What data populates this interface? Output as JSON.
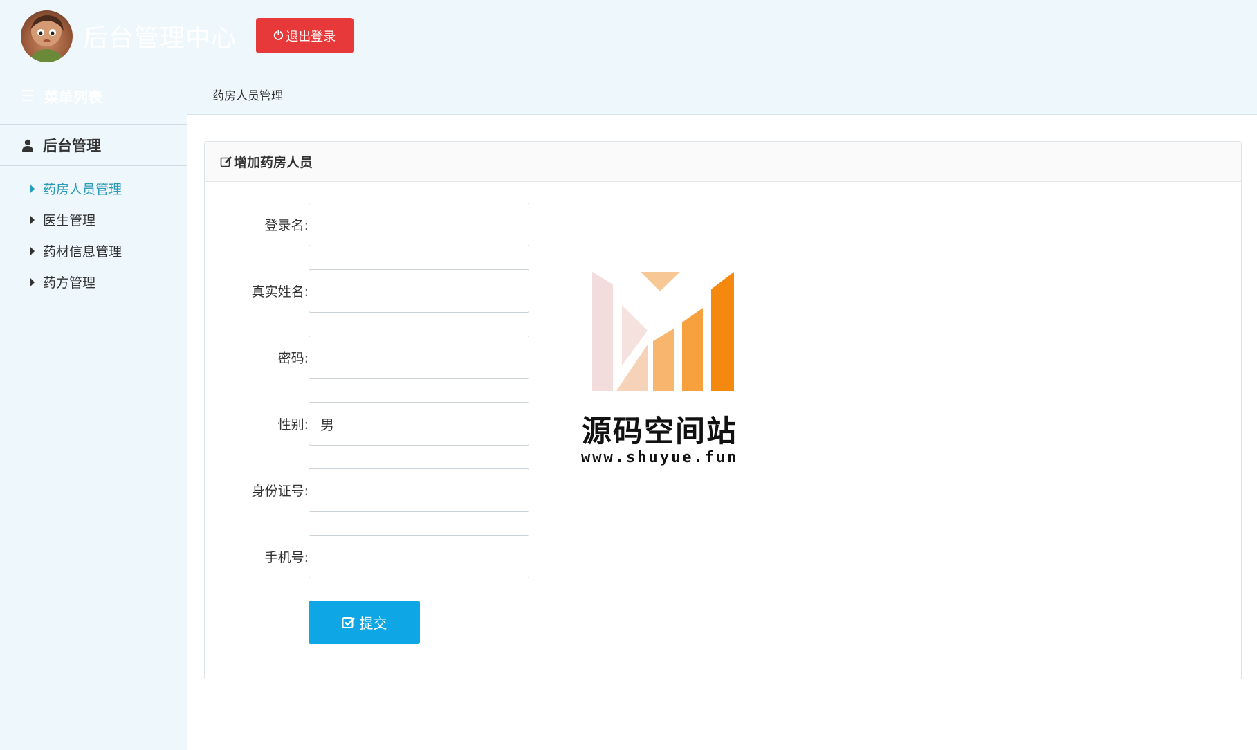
{
  "header": {
    "app_title": "后台管理中心",
    "logout_label": "退出登录",
    "logout_icon": "power-icon",
    "avatar_icon": "avatar"
  },
  "sidebar": {
    "menu_title": "菜单列表",
    "menu_icon": "list-icon",
    "group": {
      "title": "后台管理",
      "icon": "user-icon"
    },
    "items": [
      {
        "label": "药房人员管理",
        "active": true
      },
      {
        "label": "医生管理",
        "active": false
      },
      {
        "label": "药材信息管理",
        "active": false
      },
      {
        "label": "药方管理",
        "active": false
      }
    ]
  },
  "breadcrumb": {
    "current": "药房人员管理"
  },
  "panel": {
    "heading": "增加药房人员",
    "heading_icon": "edit-icon",
    "fields": [
      {
        "label": "登录名:",
        "value": ""
      },
      {
        "label": "真实姓名:",
        "value": ""
      },
      {
        "label": "密码:",
        "value": ""
      },
      {
        "label": "性别:",
        "value": "男"
      },
      {
        "label": "身份证号:",
        "value": ""
      },
      {
        "label": "手机号:",
        "value": ""
      }
    ],
    "submit_label": "提交",
    "submit_icon": "check-square-icon"
  },
  "watermark": {
    "title": "源码空间站",
    "url": "www.shuyue.fun"
  },
  "colors": {
    "background": "#eef7fb",
    "logout": "#e8393a",
    "submit": "#0ea6e4",
    "active_link": "#2a9bb8",
    "watermark_orange": "#f5880f"
  }
}
